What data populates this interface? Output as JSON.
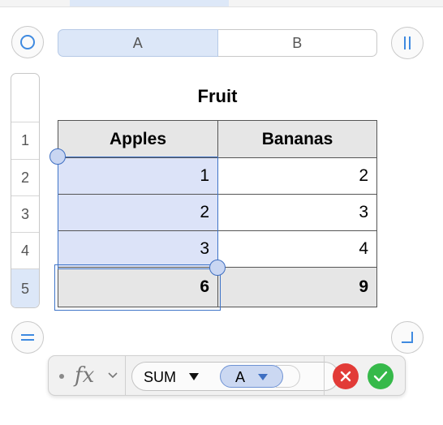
{
  "columns": [
    "A",
    "B"
  ],
  "rows": [
    "1",
    "2",
    "3",
    "4",
    "5"
  ],
  "table": {
    "title": "Fruit",
    "headers": [
      "Apples",
      "Bananas"
    ],
    "body": [
      [
        "1",
        "2"
      ],
      [
        "2",
        "3"
      ],
      [
        "3",
        "4"
      ]
    ],
    "footer": [
      "6",
      "9"
    ]
  },
  "formula": {
    "fx_label": "fx",
    "function_name": "SUM",
    "argument_token": "A"
  },
  "colors": {
    "selection": "#3f74c8",
    "selection_fill": "#dce3f8",
    "cancel": "#e23b37",
    "confirm": "#36b94a"
  },
  "icons": {
    "select_all": "circle-icon",
    "pause": "column-handle-icon",
    "row_handle": "row-handle-icon",
    "resize": "resize-corner-icon",
    "cancel": "x-icon",
    "confirm": "checkmark-icon"
  }
}
